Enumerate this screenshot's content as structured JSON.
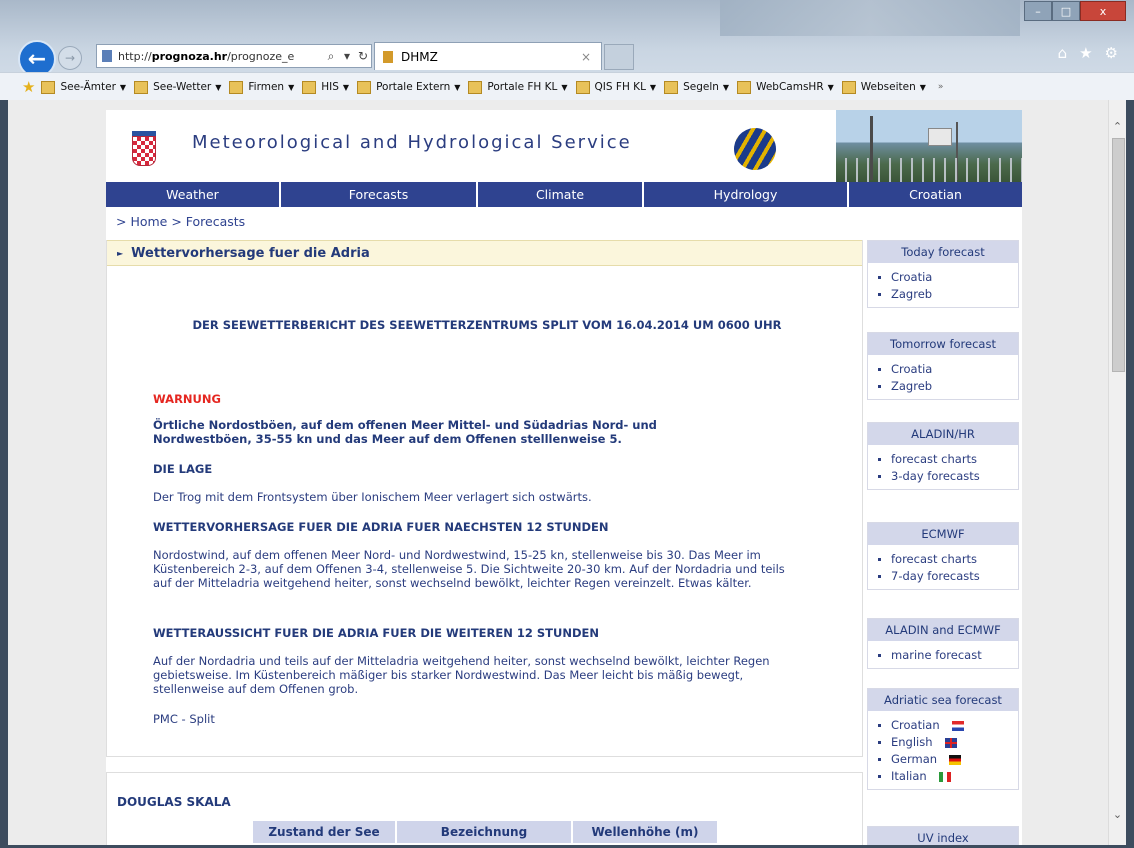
{
  "browser": {
    "back_icon": "arrow-left-icon",
    "address": {
      "prefix": "http://",
      "domain": "prognoza.hr",
      "path": "/prognoze_e",
      "search_glyph": "⌕",
      "dropdown_glyph": "▾",
      "refresh_glyph": "↻"
    },
    "tab": {
      "title": "DHMZ",
      "close": "×"
    },
    "right_icons": {
      "home": "⌂",
      "star": "★",
      "gear": "⚙"
    },
    "window_buttons": {
      "min": "–",
      "max": "□",
      "close": "x"
    },
    "favorites": [
      {
        "label": "See-Ämter"
      },
      {
        "label": "See-Wetter"
      },
      {
        "label": "Firmen"
      },
      {
        "label": "HIS"
      },
      {
        "label": "Portale Extern"
      },
      {
        "label": "Portale FH KL"
      },
      {
        "label": "QIS FH KL"
      },
      {
        "label": "Segeln"
      },
      {
        "label": "WebCamsHR"
      },
      {
        "label": "Webseiten"
      }
    ],
    "fav_more": "»"
  },
  "site": {
    "title": "Meteorological and Hydrological Service",
    "menu": [
      "Weather",
      "Forecasts",
      "Climate",
      "Hydrology",
      "Croatian"
    ],
    "breadcrumb": "> Home > Forecasts"
  },
  "content": {
    "heading": "Wettervorhersage fuer die Adria",
    "report_title": "DER SEEWETTERBERICHT DES SEEWETTERZENTRUMS SPLIT VOM 16.04.2014 UM 0600 UHR",
    "warning_label": "WARNUNG",
    "warning_text": "Örtliche Nordostböen, auf dem offenen Meer Mittel- und Südadrias Nord- und Nordwestböen, 35-55 kn und das Meer auf dem Offenen stelllenweise 5.",
    "lage_label": "DIE LAGE",
    "lage_text": "Der Trog mit dem Frontsystem über Ionischem Meer verlagert sich ostwärts.",
    "forecast_label": "WETTERVORHERSAGE FUER DIE ADRIA FUER NAECHSTEN 12 STUNDEN",
    "forecast_text": "Nordostwind, auf dem offenen Meer Nord- und Nordwestwind, 15-25 kn, stellenweise bis 30. Das Meer im Küstenbereich 2-3, auf dem Offenen 3-4, stellenweise 5. Die Sichtweite 20-30 km. Auf der Nordadria und teils auf der Mitteladria weitgehend heiter, sonst wechselnd bewölkt, leichter Regen vereinzelt. Etwas kälter.",
    "outlook_label": "WETTERAUSSICHT FUER DIE ADRIA FUER DIE WEITEREN 12 STUNDEN",
    "outlook_text": "Auf der Nordadria und teils auf der Mitteladria weitgehend heiter, sonst wechselnd bewölkt, leichter Regen gebietsweise. Im Küstenbereich mäßiger bis starker Nordwestwind. Das Meer leicht bis mäßig bewegt, stellenweise auf dem Offenen grob.",
    "signature": "PMC - Split"
  },
  "douglas": {
    "title": "DOUGLAS SKALA",
    "columns": [
      "Zustand der See",
      "Bezeichnung",
      "Wellenhöhe (m)"
    ]
  },
  "sidebar": [
    {
      "title": "Today forecast",
      "items": [
        "Croatia",
        "Zagreb"
      ]
    },
    {
      "title": "Tomorrow forecast",
      "items": [
        "Croatia",
        "Zagreb"
      ]
    },
    {
      "title": "ALADIN/HR",
      "items": [
        "forecast charts",
        "3-day forecasts"
      ]
    },
    {
      "title": "ECMWF",
      "items": [
        "forecast charts",
        "7-day forecasts"
      ]
    },
    {
      "title": "ALADIN and ECMWF",
      "items": [
        "marine forecast"
      ]
    },
    {
      "title": "Adriatic sea forecast",
      "items": [
        "Croatian",
        "English",
        "German",
        "Italian"
      ]
    },
    {
      "title": "UV index",
      "items": []
    }
  ]
}
